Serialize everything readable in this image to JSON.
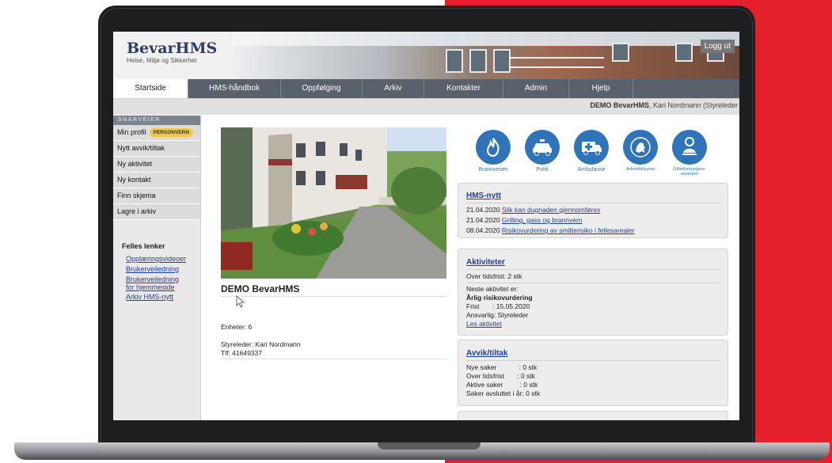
{
  "app": {
    "logo_title": "BevarHMS",
    "logo_subtitle": "Helse, Miljø og Sikkerhet",
    "logout_label": "Logg ut"
  },
  "nav": {
    "items": [
      "Startside",
      "HMS-håndbok",
      "Oppfølging",
      "Arkiv",
      "Kontakter",
      "Admin",
      "Hjelp"
    ],
    "active": "Startside"
  },
  "userbar": {
    "org": "DEMO BevarHMS",
    "user": ", Kari Nordmann (Styreleder"
  },
  "sidebar": {
    "header": "SNARVEIER",
    "items": [
      {
        "label": "Min profil",
        "badge": "PERSONVERN"
      },
      {
        "label": "Nytt avvik/tiltak"
      },
      {
        "label": "Ny aktivitet"
      },
      {
        "label": "Ny kontakt"
      },
      {
        "label": "Finn skjema"
      },
      {
        "label": "Lagre i arkiv"
      }
    ],
    "links_title": "Felles lenker",
    "links": [
      "Opplæringsvideoer",
      "Brukerveiledning",
      "Brukerveiledning\nfor hjemmeside",
      "Arkiv HMS-nytt"
    ]
  },
  "org": {
    "name": "DEMO BevarHMS",
    "units": "Enheter: 6",
    "board_leader": "Styreleder: Kari Nordmann",
    "phone": "Tlf: 41649337"
  },
  "emergency": [
    {
      "label": "Brannvesen",
      "icon": "fire-icon"
    },
    {
      "label": "Politi",
      "icon": "police-car-icon"
    },
    {
      "label": "Ambulanse",
      "icon": "ambulance-icon"
    },
    {
      "label": "Arbeidstilsynet",
      "icon": "lion-emblem-icon"
    },
    {
      "label": "Giftinformasjons-\nsentralen",
      "icon": "poison-info-icon"
    }
  ],
  "hms_news": {
    "title": "HMS-nytt",
    "items": [
      {
        "date": "21.04.2020",
        "text": "Slik kan dugnaden gjennomføres"
      },
      {
        "date": "21.04.2020",
        "text": "Grilling, gass og brannvern"
      },
      {
        "date": "08.04.2020",
        "text": "Risikovurdering av smitterisiko i fellesarealer"
      }
    ]
  },
  "activities": {
    "title": "Aktiviteter",
    "overdue": "Over tidsfrist: 2 stk",
    "next_label": "Neste aktivitet er:",
    "next_name": "Årlig risikovurdering",
    "deadline": "Frist       : 15.05.2020",
    "responsible": "Ansvarlig: Styreleder",
    "read_link": "Les aktivitet"
  },
  "deviations": {
    "title": "Avvik/tiltak",
    "rows": [
      "Nye saker            : 0 stk",
      "Over tidsfrist       : 0 stk",
      "Aktive saker         : 0 stk",
      "Saker avsluttet i år: 0 stk"
    ]
  },
  "colors": {
    "accent_red": "#e3202c",
    "nav_bg": "#59626a",
    "link_blue": "#1f3fa0",
    "icon_blue": "#2f74b8",
    "badge_yellow": "#f0c94a"
  }
}
